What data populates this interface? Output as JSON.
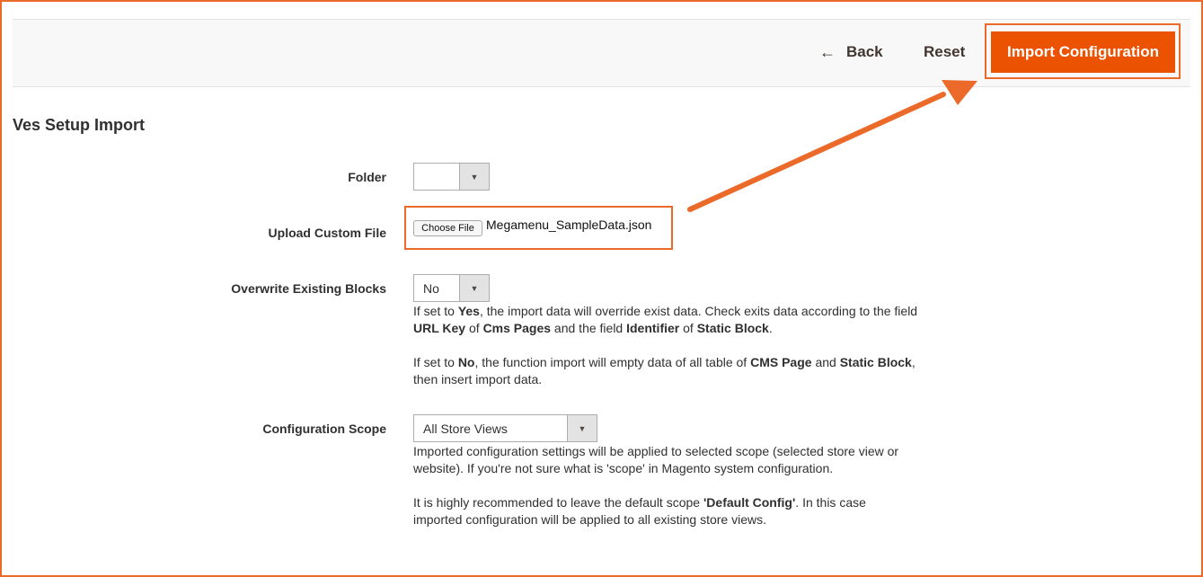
{
  "header": {
    "back_label": "Back",
    "reset_label": "Reset",
    "import_label": "Import Configuration"
  },
  "section": {
    "title": "Ves Setup Import"
  },
  "fields": {
    "folder": {
      "label": "Folder",
      "value": ""
    },
    "upload": {
      "label": "Upload Custom File",
      "button_label": "Choose File",
      "file_name": "Megamenu_SampleData.json"
    },
    "overwrite": {
      "label": "Overwrite Existing Blocks",
      "value": "No",
      "note1": {
        "p1": "If set to ",
        "b1": "Yes",
        "p2": ", the import data will override exist data. Check exits data according to the field ",
        "b2": "URL Key",
        "p3": " of ",
        "b3": "Cms Pages",
        "p4": " and the field ",
        "b4": "Identifier",
        "p5": " of ",
        "b5": "Static Block",
        "p6": "."
      },
      "note2": {
        "p1": "If set to ",
        "b1": "No",
        "p2": ", the function import will empty data of all table of ",
        "b2": "CMS Page",
        "p3": " and ",
        "b3": "Static Block",
        "p4": ", then insert import data."
      }
    },
    "scope": {
      "label": "Configuration Scope",
      "value": "All Store Views",
      "note1": "Imported configuration settings will be applied to selected scope (selected store view or website). If you're not sure what is 'scope' in Magento system configuration.",
      "note2": {
        "p1": "It is highly recommended to leave the default scope ",
        "b1": "'Default Config'",
        "p2": ". In this case imported configuration will be applied to all existing store views."
      }
    }
  },
  "colors": {
    "accent": "#eb5202",
    "annotation": "#eb6a2a"
  },
  "icons": {
    "back": "arrow-left-icon",
    "dropdown": "caret-down-icon"
  }
}
